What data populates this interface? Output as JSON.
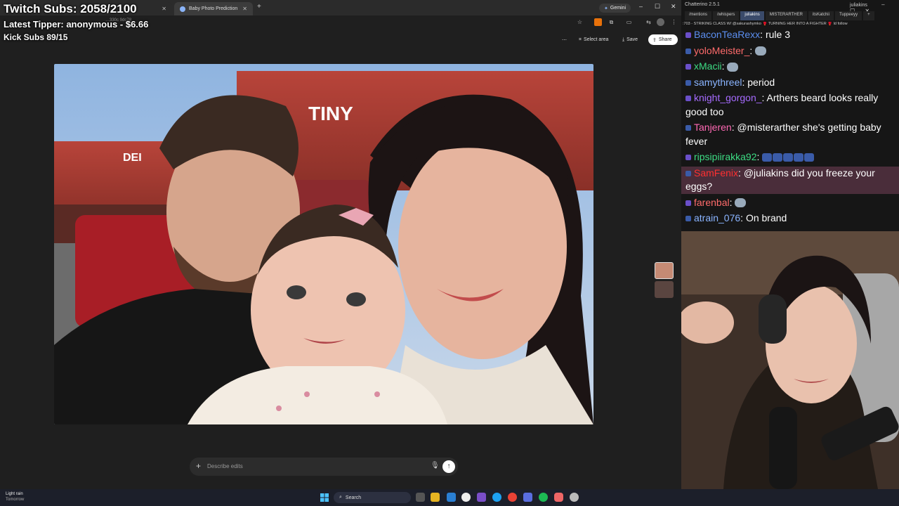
{
  "browser": {
    "tabs": [
      {
        "label": ""
      },
      {
        "label": "Baby Photo Prediction"
      }
    ],
    "new_tab": "+",
    "gemini_chip": "Gemini",
    "window_controls": [
      "–",
      "☐",
      "✕"
    ],
    "url": "…330c 9dc78",
    "toolbar": {
      "more": "⋯",
      "select_area": "Select area",
      "save": "Save",
      "share": "Share"
    },
    "edit_input": {
      "placeholder": "Describe edits",
      "add": "+"
    },
    "photo_sign_text": "TINY",
    "photo_store_text": "DEI"
  },
  "overlays": {
    "twitch_subs": "Twitch Subs: 2058/2100",
    "latest_tipper": "Latest Tipper: anonymous - $6.66",
    "kick_subs": "Kick Subs 89/15"
  },
  "chat": {
    "title": "Chatterino 2.5.1",
    "channel": "juliakins",
    "tabs": [
      "/mentions",
      "/whispers",
      "juliakins",
      "MISTERARTHER",
      "itsKatchii",
      "Tuppeeyy",
      "+"
    ],
    "active_tab": 2,
    "banner": ":703 - STRIKING CLASS W/ @sakurashymko 🥊 TURNING HER INTO A FIGHTER 🥊 ld   follow",
    "messages": [
      {
        "user": "BaconTeaRexx",
        "color": "#5b8ef0",
        "text": "rule 3",
        "emote": false
      },
      {
        "user": "yoloMeister_",
        "color": "#ff6b6b",
        "text": "",
        "emote": true
      },
      {
        "user": "xMacii",
        "color": "#3ddc84",
        "text": "",
        "emote": true
      },
      {
        "user": "samythreel",
        "color": "#8ab4ff",
        "text": "period",
        "emote": false
      },
      {
        "user": "knight_gorgon_",
        "color": "#a66bff",
        "text": "Arthers beard looks really good too",
        "emote": false
      },
      {
        "user": "Tanjeren",
        "color": "#ff69b4",
        "text": "@misterarther she's getting baby fever",
        "emote": false
      },
      {
        "user": "ripsipiirakka92",
        "color": "#3ddc84",
        "text": "",
        "emote": "blue"
      },
      {
        "user": "SamFenix",
        "color": "#ff3030",
        "text": "@juliakins did you freeze your eggs?",
        "emote": false,
        "highlight": true
      },
      {
        "user": "farenbal",
        "color": "#ff6b6b",
        "text": "",
        "emote": true
      },
      {
        "user": "atrain_076",
        "color": "#8ab4ff",
        "text": "On brand",
        "emote": false
      }
    ]
  },
  "taskbar": {
    "weather_line1": "Light rain",
    "weather_line2": "Tomorrow",
    "search": "Search"
  },
  "colors": {
    "browser_bg": "#1f1f1f",
    "chat_bg": "#161616",
    "taskbar_bg": "#1c1f2a",
    "highlight": "#4a2d3a"
  }
}
